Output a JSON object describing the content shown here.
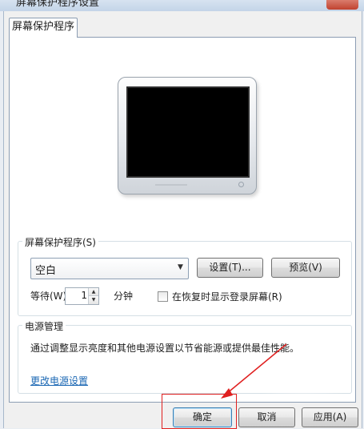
{
  "window": {
    "title": "屏幕保护程序设置"
  },
  "tabs": [
    {
      "label": "屏幕保护程序"
    }
  ],
  "screensaver_group": {
    "legend": "屏幕保护程序(S)",
    "selected": "空白",
    "settings_label": "设置(T)...",
    "preview_label": "预览(V)",
    "wait_label": "等待(W):",
    "wait_value": "1",
    "wait_unit": "分钟",
    "resume_label": "在恢复时显示登录屏幕(R)",
    "resume_checked": false
  },
  "power_group": {
    "legend": "电源管理",
    "description": "通过调整显示亮度和其他电源设置以节省能源或提供最佳性能。",
    "link": "更改电源设置"
  },
  "footer": {
    "ok_label": "确定",
    "cancel_label": "取消",
    "apply_label": "应用(A)"
  },
  "annotation": {
    "color": "#e02020"
  }
}
